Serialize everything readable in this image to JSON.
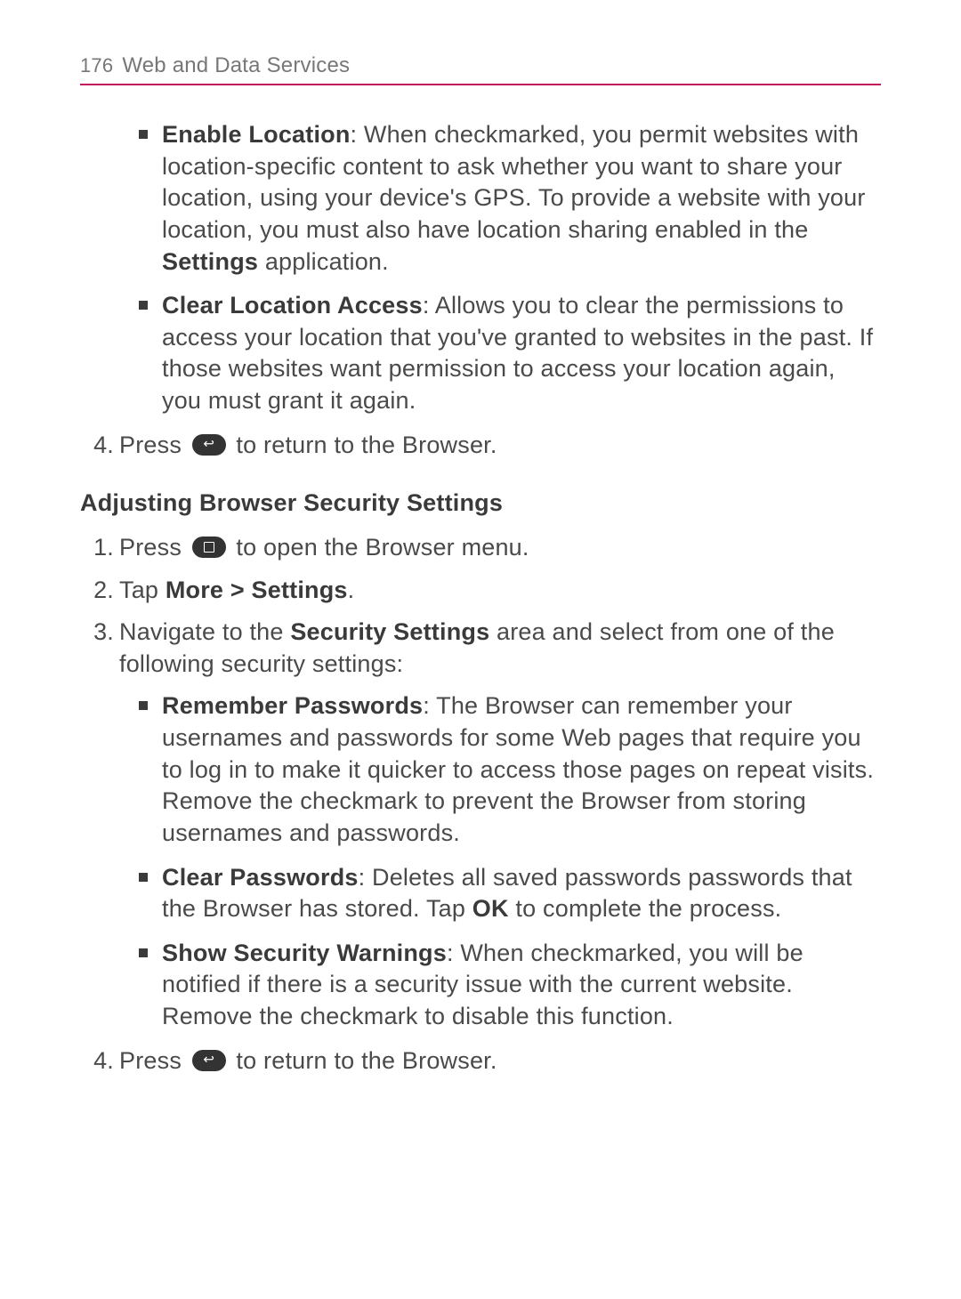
{
  "header": {
    "page_number": "176",
    "section": "Web and Data Services"
  },
  "bullets_top": [
    {
      "title": "Enable Location",
      "text_before_bold": ": When checkmarked, you permit websites with location-specific content to ask whether you want to share your location, using your device's GPS. To provide a website with your location, you must also have location sharing enabled in the ",
      "inline_bold": "Settings",
      "text_after_bold": " application."
    },
    {
      "title": "Clear Location Access",
      "text_before_bold": ": Allows you to clear the permissions to access your location that you've granted to websites in the past. If those websites want permission to access your location again, you must grant it again.",
      "inline_bold": "",
      "text_after_bold": ""
    }
  ],
  "step4_top": {
    "num": "4.",
    "before_icon": "Press ",
    "after_icon": " to return to the Browser."
  },
  "heading": "Adjusting Browser Security Settings",
  "steps": [
    {
      "num": "1.",
      "before_icon": "Press ",
      "after_icon": " to open the Browser menu.",
      "icon": "menu"
    },
    {
      "num": "2.",
      "plain_before": "Tap ",
      "bold": "More > Settings",
      "plain_after": "."
    },
    {
      "num": "3.",
      "plain_before": "Navigate to the ",
      "bold": "Security Settings",
      "plain_after": " area and select from one of the following security settings:"
    }
  ],
  "bullets_security": [
    {
      "title": "Remember Passwords",
      "body": ": The Browser can remember your usernames and passwords for some Web pages that require you to log in to make it quicker to access those pages on repeat visits. Remove the checkmark to prevent the Browser from storing usernames and passwords."
    },
    {
      "title": "Clear Passwords",
      "body_before": ": Deletes all saved passwords passwords that the Browser has stored. Tap ",
      "inline_bold": "OK",
      "body_after": " to complete the process."
    },
    {
      "title": "Show Security Warnings",
      "body": ": When checkmarked, you will be notified if there is a security issue with the current website. Remove the checkmark to disable this function."
    }
  ],
  "step4_bottom": {
    "num": "4.",
    "before_icon": "Press ",
    "after_icon": " to return to the Browser."
  }
}
